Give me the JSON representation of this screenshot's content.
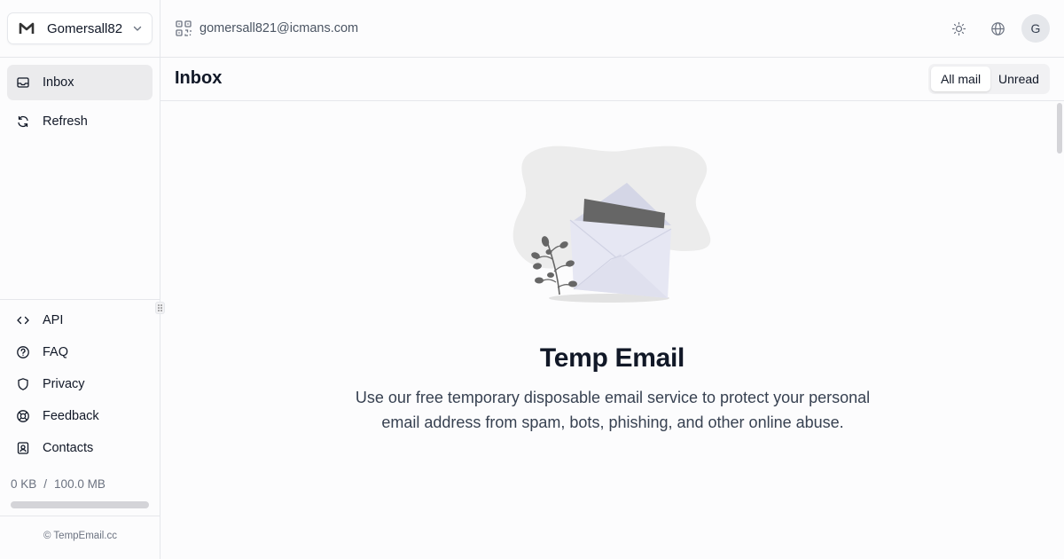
{
  "account": {
    "name": "Gomersall82",
    "logo_icon": "gmail-m-icon"
  },
  "email_address": "gomersall821@icmans.com",
  "avatar_letter": "G",
  "nav": {
    "inbox": "Inbox",
    "refresh": "Refresh"
  },
  "footer_nav": {
    "api": "API",
    "faq": "FAQ",
    "privacy": "Privacy",
    "feedback": "Feedback",
    "contacts": "Contacts"
  },
  "storage": {
    "used": "0 KB",
    "separator": "/",
    "total": "100.0 MB",
    "used_fraction": 0
  },
  "copyright": "© TempEmail.cc",
  "inbox": {
    "title": "Inbox",
    "filters": {
      "all": "All mail",
      "unread": "Unread"
    }
  },
  "hero": {
    "title": "Temp Email",
    "line1": "Use our free temporary disposable email service to protect your personal",
    "line2": "email address from spam, bots, phishing, and other online abuse."
  },
  "colors": {
    "active_nav_bg": "#ebebed",
    "border": "#e5e7eb",
    "text": "#111827",
    "muted": "#6b7280"
  }
}
